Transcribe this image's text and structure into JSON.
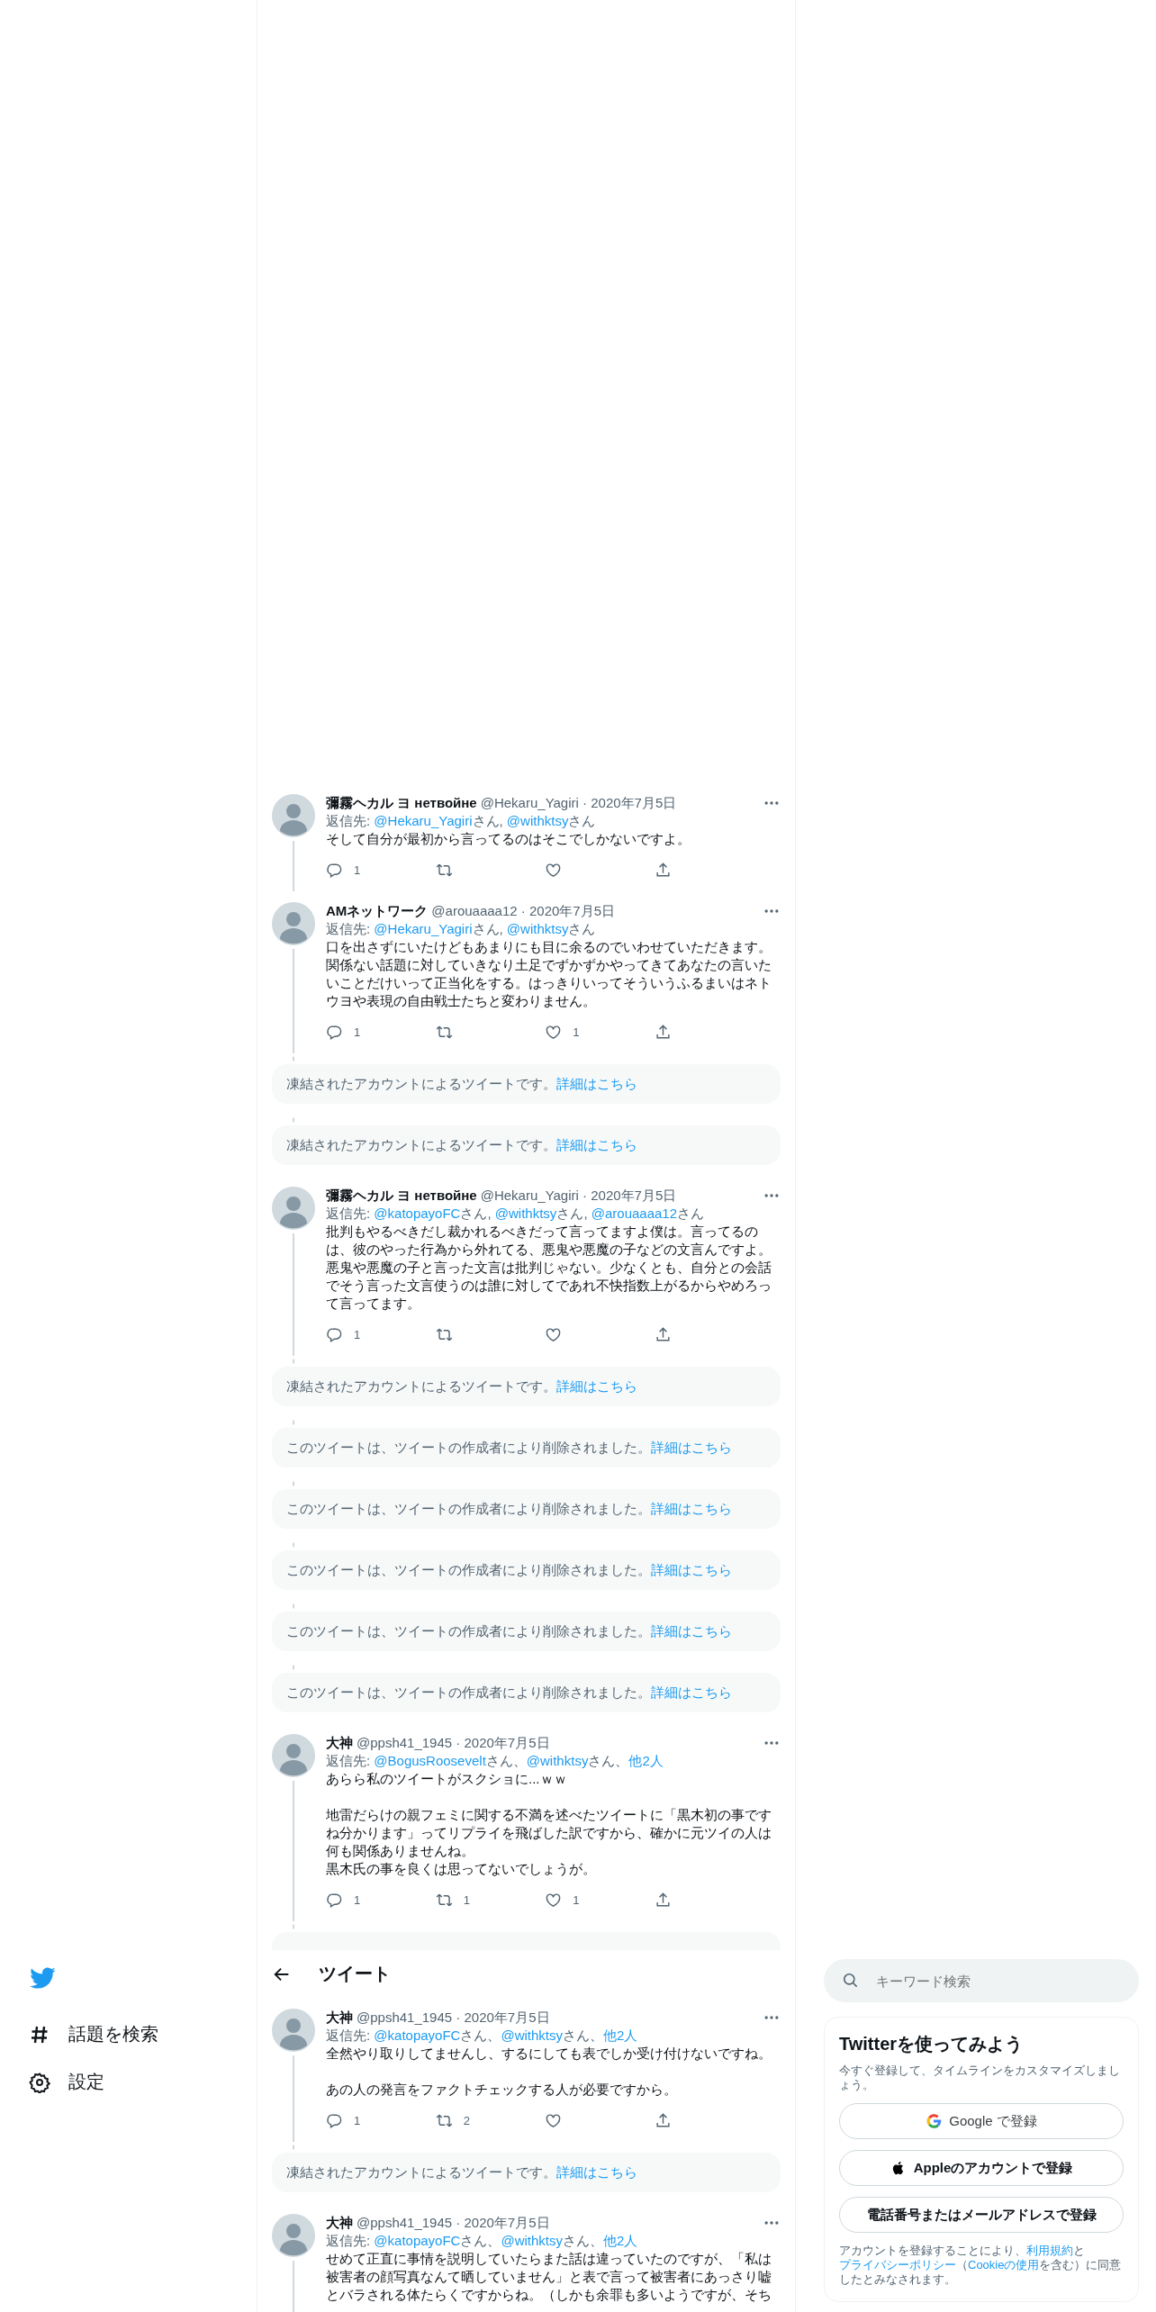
{
  "sidebar": {
    "items": [
      {
        "kind": "explore",
        "label": "話題を検索"
      },
      {
        "kind": "settings",
        "label": "設定"
      }
    ]
  },
  "timeline": [
    {
      "kind": "tweet",
      "name": "彌霧ヘカル ヨ нетвойне",
      "meta": "@Hekaru_Yagiri · 2020年7月5日",
      "reply_to": [
        {
          "text": "返信先: ",
          "link": false
        },
        {
          "text": "@Hekaru_Yagiri",
          "link": true
        },
        {
          "text": "さん, ",
          "link": false
        },
        {
          "text": "@withktsy",
          "link": true
        },
        {
          "text": "さん",
          "link": false
        }
      ],
      "paragraphs": [
        [
          "そして自分が最初から言ってるのはそこでしかないですよ。"
        ]
      ],
      "stats": {
        "replies": "1"
      }
    },
    {
      "kind": "tweet",
      "name": "AMネットワーク",
      "meta": "@arouaaaa12 · 2020年7月5日",
      "reply_to": [
        {
          "text": "返信先: ",
          "link": false
        },
        {
          "text": "@Hekaru_Yagiri",
          "link": true
        },
        {
          "text": "さん, ",
          "link": false
        },
        {
          "text": "@withktsy",
          "link": true
        },
        {
          "text": "さん",
          "link": false
        }
      ],
      "paragraphs": [
        [
          "口を出さずにいたけどもあまりにも目に余るのでいわせていただきます。関係ない話題に対していきなり土足でずかずかやってきてあなたの言いたいことだけいって正当化をする。はっきりいってそういうふるまいはネトウヨや表現の自由戦士たちと変わりません。"
        ]
      ],
      "stats": {
        "replies": "1",
        "likes": "1"
      }
    },
    {
      "kind": "notice",
      "text": "凍結されたアカウントによるツイートです。",
      "link": "詳細はこちら"
    },
    {
      "kind": "notice",
      "text": "凍結されたアカウントによるツイートです。",
      "link": "詳細はこちら"
    },
    {
      "kind": "tweet",
      "name": "彌霧ヘカル ヨ нетвойне",
      "meta": "@Hekaru_Yagiri · 2020年7月5日",
      "reply_to": [
        {
          "text": "返信先: ",
          "link": false
        },
        {
          "text": "@katopayoFC",
          "link": true
        },
        {
          "text": "さん, ",
          "link": false
        },
        {
          "text": "@withktsy",
          "link": true
        },
        {
          "text": "さん, ",
          "link": false
        },
        {
          "text": "@arouaaaa12",
          "link": true
        },
        {
          "text": "さん",
          "link": false
        }
      ],
      "paragraphs": [
        [
          "批判もやるべきだし裁かれるべきだって言ってますよ僕は。言ってるのは、彼のやった行為から外れてる、悪鬼や悪魔の子などの文言んですよ。悪鬼や悪魔の子と言った文言は批判じゃない。少なくとも、自分との会話でそう言った文言使うのは誰に対してであれ不快指数上がるからやめろって言ってます。"
        ]
      ],
      "stats": {
        "replies": "1"
      }
    },
    {
      "kind": "notice",
      "text": "凍結されたアカウントによるツイートです。",
      "link": "詳細はこちら"
    },
    {
      "kind": "notice",
      "text": "このツイートは、ツイートの作成者により削除されました。",
      "link": "詳細はこちら"
    },
    {
      "kind": "notice",
      "text": "このツイートは、ツイートの作成者により削除されました。",
      "link": "詳細はこちら"
    },
    {
      "kind": "notice",
      "text": "このツイートは、ツイートの作成者により削除されました。",
      "link": "詳細はこちら"
    },
    {
      "kind": "notice",
      "text": "このツイートは、ツイートの作成者により削除されました。",
      "link": "詳細はこちら"
    },
    {
      "kind": "notice",
      "text": "このツイートは、ツイートの作成者により削除されました。",
      "link": "詳細はこちら"
    },
    {
      "kind": "tweet",
      "name": "大神",
      "meta": "@ppsh41_1945 · 2020年7月5日",
      "reply_to": [
        {
          "text": "返信先: ",
          "link": false
        },
        {
          "text": "@BogusRoosevelt",
          "link": true
        },
        {
          "text": "さん、",
          "link": false
        },
        {
          "text": "@withktsy",
          "link": true
        },
        {
          "text": "さん、",
          "link": false
        },
        {
          "text": "他2人",
          "link": true
        }
      ],
      "paragraphs": [
        [
          "あらら私のツイートがスクショに...ｗｗ"
        ],
        [
          "地雷だらけの親フェミに関する不満を述べたツイートに「黒木初の事ですね分かります」ってリプライを飛ばした訳ですから、確かに元ツイの人は何も関係ありませんね。",
          "黒木氏の事を良くは思ってないでしょうが。"
        ]
      ],
      "stats": {
        "replies": "1",
        "retweets": "1",
        "likes": "1"
      }
    },
    {
      "kind": "notice_cut"
    }
  ],
  "header": {
    "title": "ツイート"
  },
  "timeline_below": [
    {
      "kind": "tweet",
      "name": "大神",
      "meta": "@ppsh41_1945 · 2020年7月5日",
      "reply_to": [
        {
          "text": "返信先: ",
          "link": false
        },
        {
          "text": "@katopayoFC",
          "link": true
        },
        {
          "text": "さん、",
          "link": false
        },
        {
          "text": "@withktsy",
          "link": true
        },
        {
          "text": "さん、",
          "link": false
        },
        {
          "text": "他2人",
          "link": true
        }
      ],
      "paragraphs": [
        [
          "全然やり取りしてませんし、するにしても表でしか受け付けないですね。"
        ],
        [
          "あの人の発言をファクトチェックする人が必要ですから。"
        ]
      ],
      "stats": {
        "replies": "1",
        "retweets": "2"
      }
    },
    {
      "kind": "notice",
      "text": "凍結されたアカウントによるツイートです。",
      "link": "詳細はこちら"
    },
    {
      "kind": "tweet",
      "name": "大神",
      "meta": "@ppsh41_1945 · 2020年7月5日",
      "reply_to": [
        {
          "text": "返信先: ",
          "link": false
        },
        {
          "text": "@katopayoFC",
          "link": true
        },
        {
          "text": "さん、",
          "link": false
        },
        {
          "text": "@withktsy",
          "link": true
        },
        {
          "text": "さん、",
          "link": false
        },
        {
          "text": "他2人",
          "link": true
        }
      ],
      "paragraphs": [
        [
          "せめて正直に事情を説明していたらまた話は違っていたのですが、「私は被害者の顔写真なんて晒していません」と表で言って被害者にあっさり嘘とバラされる体たらくですからね。（しかも余罪も多いようですが、そち"
        ]
      ]
    }
  ],
  "search": {
    "placeholder": "キーワード検索"
  },
  "signup": {
    "title": "Twitterを使ってみよう",
    "subtitle": "今すぐ登録して、タイムラインをカスタマイズしましょう。",
    "buttons": [
      {
        "kind": "google",
        "label": "Google で登録"
      },
      {
        "kind": "apple",
        "label": "Appleのアカウントで登録"
      },
      {
        "kind": "phone",
        "label": "電話番号またはメールアドレスで登録"
      }
    ],
    "legal": [
      {
        "text": "アカウントを登録することにより、",
        "link": false
      },
      {
        "text": "利用規約",
        "link": true
      },
      {
        "text": "と",
        "link": false
      },
      {
        "text": "プライバシーポリシー",
        "link": true
      },
      {
        "text": "（",
        "link": false
      },
      {
        "text": "Cookieの使用",
        "link": true
      },
      {
        "text": "を含む）に同意したとみなされます。",
        "link": false
      }
    ]
  }
}
